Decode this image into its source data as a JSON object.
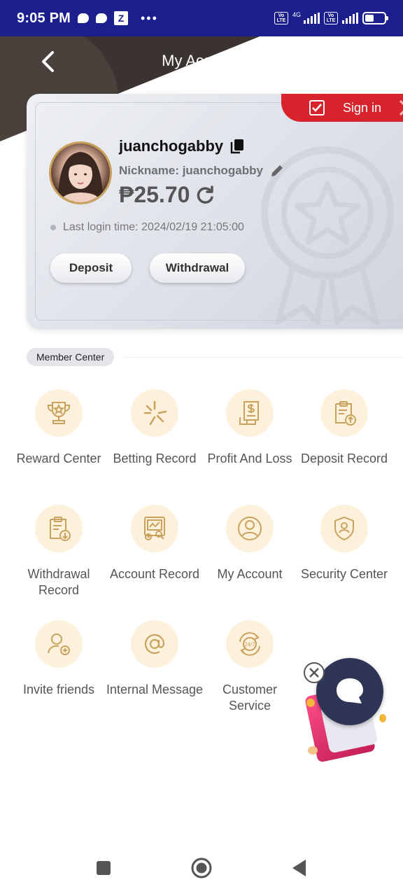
{
  "status_bar": {
    "time": "9:05 PM",
    "z_label": "Z",
    "more": "•••",
    "network": "4G",
    "volte": "Vo LTE"
  },
  "header": {
    "title": "My Account",
    "back_icon": "chevron-left-icon"
  },
  "profile": {
    "sign_in_label": "Sign in",
    "username": "juanchogabby",
    "nickname": "Nickname: juanchogabby",
    "balance": "₱25.70",
    "last_login": "Last login time: 2024/02/19 21:05:00",
    "deposit_label": "Deposit",
    "withdrawal_label": "Withdrawal"
  },
  "member_center": {
    "label": "Member Center",
    "items": [
      {
        "label": "Reward Center",
        "icon": "trophy-icon"
      },
      {
        "label": "Betting Record",
        "icon": "shuttle-icon"
      },
      {
        "label": "Profit And Loss",
        "icon": "dollar-doc-icon"
      },
      {
        "label": "Deposit Record",
        "icon": "clipboard-up-icon"
      },
      {
        "label": "Withdrawal Record",
        "icon": "clipboard-down-icon"
      },
      {
        "label": "Account Record",
        "icon": "statement-icon"
      },
      {
        "label": "My Account",
        "icon": "user-circle-icon"
      },
      {
        "label": "Security Center",
        "icon": "shield-user-icon"
      },
      {
        "label": "Invite friends",
        "icon": "add-user-icon"
      },
      {
        "label": "Internal Message",
        "icon": "at-sign-icon"
      },
      {
        "label": "Customer Service",
        "icon": "support-24-7-icon"
      }
    ]
  },
  "colors": {
    "status_bar": "#1b1f8e",
    "header": "#3a3330",
    "sign_in": "#d7232b",
    "icon_bg": "#fdf1dc",
    "icon_stroke": "#c9a25e"
  }
}
